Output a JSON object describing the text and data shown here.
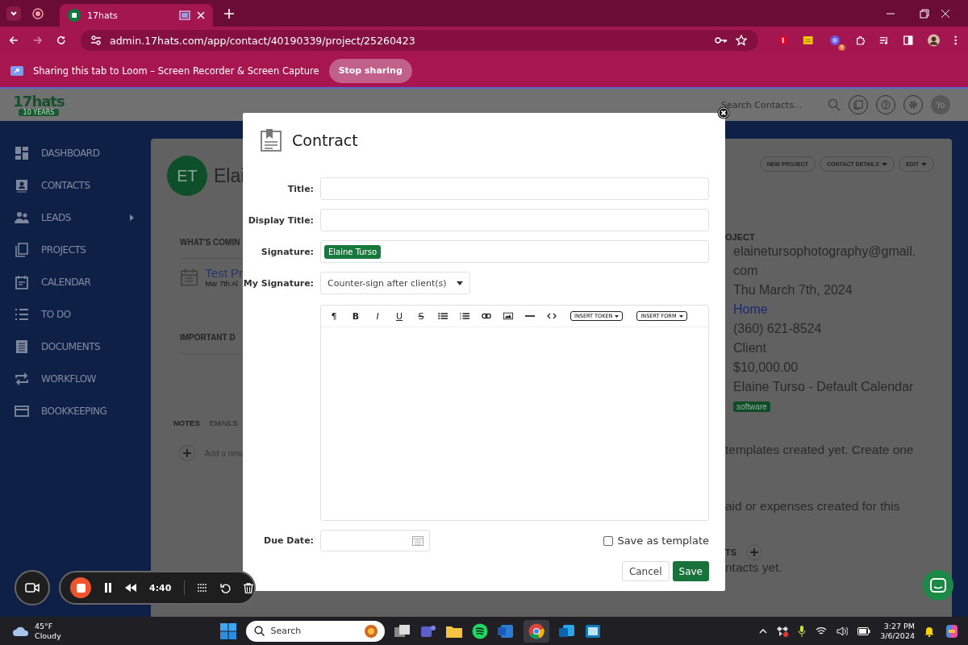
{
  "browser": {
    "tabs": [
      {
        "title": "17hats",
        "selected": true
      }
    ],
    "url": "admin.17hats.com/app/contact/40190339/project/25260423",
    "extension_badge": "9"
  },
  "sharing_bar": {
    "message": "Sharing this tab to Loom – Screen Recorder & Screen Capture",
    "button": "Stop sharing"
  },
  "app_header": {
    "logo": "17hats",
    "logo_ribbon": "10 YEARS",
    "search_placeholder": "Search Contacts...",
    "avatar": "Yo"
  },
  "sidebar": {
    "items": [
      {
        "label": "DASHBOARD",
        "submenu": false
      },
      {
        "label": "CONTACTS",
        "submenu": false
      },
      {
        "label": "LEADS",
        "submenu": true
      },
      {
        "label": "PROJECTS",
        "submenu": false
      },
      {
        "label": "CALENDAR",
        "submenu": false
      },
      {
        "label": "TO DO",
        "submenu": false
      },
      {
        "label": "DOCUMENTS",
        "submenu": false
      },
      {
        "label": "WORKFLOW",
        "submenu": false
      },
      {
        "label": "BOOKKEEPING",
        "submenu": false
      }
    ]
  },
  "contact": {
    "initials": "ET",
    "name": "Elai",
    "buttons": [
      {
        "label": "NEW PROJECT",
        "dropdown": false
      },
      {
        "label": "CONTACT DETAILS",
        "dropdown": true
      },
      {
        "label": "EDIT",
        "dropdown": true
      }
    ],
    "upcoming_heading": "WHAT'S COMIN",
    "event": {
      "title": "Test Pr",
      "date": "Mar 7th Al"
    },
    "important_heading": "IMPORTANT D",
    "tabs": [
      {
        "label": "NOTES",
        "selected": true
      },
      {
        "label": "EMAILS",
        "selected": false
      }
    ],
    "add_note": "Add a new",
    "project_heading": "OJECT",
    "details": [
      {
        "text": "elainetursophotography@gmail.com",
        "kind": "text"
      },
      {
        "text": "Thu March 7th, 2024",
        "kind": "text"
      },
      {
        "text": "Home",
        "kind": "link"
      },
      {
        "text": "(360) 621-8524",
        "kind": "text"
      },
      {
        "text": "Client",
        "kind": "text"
      },
      {
        "text": "$10,000.00",
        "kind": "text"
      },
      {
        "text": "Elaine Turso - Default Calendar",
        "kind": "text"
      }
    ],
    "tag": "software",
    "templates_note": "templates created yet. Create one",
    "expenses_note": "aid or expenses created for this",
    "contacts_heading": "TS",
    "contacts_note": "ntacts yet."
  },
  "modal": {
    "title": "Contract",
    "fields": [
      {
        "label": "Title:",
        "kind": "input"
      },
      {
        "label": "Display Title:",
        "kind": "input"
      },
      {
        "label": "Signature:",
        "kind": "chips",
        "chip": "Elaine Turso"
      },
      {
        "label": "My Signature:",
        "kind": "select",
        "value": "Counter-sign after client(s)"
      }
    ],
    "toolbar": {
      "glyphs": [
        "¶",
        "B",
        "I",
        "U",
        "S"
      ],
      "dropdowns": [
        "INSERT TOKEN",
        "INSERT FORM"
      ]
    },
    "due_date_label": "Due Date:",
    "save_as_template": {
      "label": "Save as template",
      "checked": false
    },
    "cancel": "Cancel",
    "save": "Save"
  },
  "recorder": {
    "time": "4:40"
  },
  "taskbar": {
    "temperature": "45°F",
    "weather": "Cloudy",
    "search": "Search",
    "time": "3:27 PM",
    "date": "3/6/2024"
  }
}
